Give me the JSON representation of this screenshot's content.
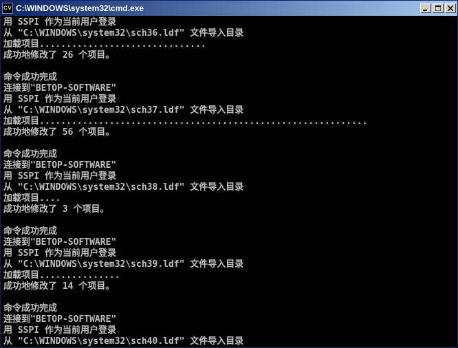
{
  "window": {
    "title": "C:\\WINDOWS\\system32\\cmd.exe",
    "icon_label": "cv"
  },
  "console": {
    "lines": [
      "用 SSPI 作为当前用户登录",
      "从 \"C:\\WINDOWS\\system32\\sch36.ldf\" 文件导入目录",
      "加载项目...............................",
      "成功地修改了 26 个项目。",
      "",
      "命令成功完成",
      "连接到\"BETOP-SOFTWARE\"",
      "用 SSPI 作为当前用户登录",
      "从 \"C:\\WINDOWS\\system32\\sch37.ldf\" 文件导入目录",
      "加载项目.............................................................",
      "成功地修改了 56 个项目。",
      "",
      "命令成功完成",
      "连接到\"BETOP-SOFTWARE\"",
      "用 SSPI 作为当前用户登录",
      "从 \"C:\\WINDOWS\\system32\\sch38.ldf\" 文件导入目录",
      "加载项目....",
      "成功地修改了 3 个项目。",
      "",
      "命令成功完成",
      "连接到\"BETOP-SOFTWARE\"",
      "用 SSPI 作为当前用户登录",
      "从 \"C:\\WINDOWS\\system32\\sch39.ldf\" 文件导入目录",
      "加载项目...............",
      "成功地修改了 14 个项目。",
      "",
      "命令成功完成",
      "连接到\"BETOP-SOFTWARE\"",
      "用 SSPI 作为当前用户登录",
      "从 \"C:\\WINDOWS\\system32\\sch40.ldf\" 文件导入目录"
    ]
  }
}
